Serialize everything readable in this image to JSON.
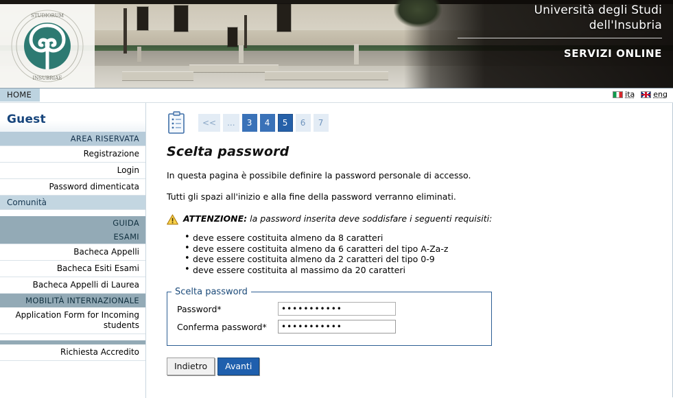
{
  "header": {
    "university_line1": "Università degli Studi",
    "university_line2": "dell'Insubria",
    "services": "SERVIZI ONLINE",
    "logo_alt": "university-seal"
  },
  "navbar": {
    "home": "HOME",
    "languages": [
      {
        "code": "ita",
        "label": "ita",
        "flag": "flag-italy-icon"
      },
      {
        "code": "eng",
        "label": "eng",
        "flag": "flag-uk-icon"
      }
    ]
  },
  "sidebar": {
    "user": "Guest",
    "sections": [
      {
        "type": "group-light",
        "label": "AREA RISERVATA"
      },
      {
        "type": "link",
        "label": "Registrazione"
      },
      {
        "type": "link",
        "label": "Login"
      },
      {
        "type": "link",
        "label": "Password dimenticata"
      },
      {
        "type": "sub",
        "label": "Comunità"
      },
      {
        "type": "spacer",
        "label": ""
      },
      {
        "type": "group-dark",
        "label": "GUIDA"
      },
      {
        "type": "group-dark",
        "label": "ESAMI"
      },
      {
        "type": "link",
        "label": "Bacheca Appelli"
      },
      {
        "type": "link",
        "label": "Bacheca Esiti Esami"
      },
      {
        "type": "link",
        "label": "Bacheca Appelli di Laurea"
      },
      {
        "type": "group-dark",
        "label": "MOBILITÀ INTERNAZIONALE"
      },
      {
        "type": "link",
        "label": "Application Form for Incoming students"
      },
      {
        "type": "rule",
        "label": ""
      },
      {
        "type": "link-plain",
        "label": "Richiesta Accredito"
      }
    ]
  },
  "content": {
    "clipboard_icon": "clipboard-checklist-icon",
    "steps": [
      {
        "label": "<<",
        "state": "nav"
      },
      {
        "label": "...",
        "state": "nav"
      },
      {
        "label": "3",
        "state": "done"
      },
      {
        "label": "4",
        "state": "done"
      },
      {
        "label": "5",
        "state": "current"
      },
      {
        "label": "6",
        "state": "pending"
      },
      {
        "label": "7",
        "state": "pending"
      }
    ],
    "title": "Scelta password",
    "paragraph1": "In questa pagina è possibile definire la password personale di accesso.",
    "paragraph2": "Tutti gli spazi all'inizio e alla fine della password verranno eliminati.",
    "warning_icon": "warning-triangle-icon",
    "warning_lead": "ATTENZIONE:",
    "warning_rest": " la password inserita deve soddisfare i seguenti requisiti:",
    "requirements": [
      "deve essere costituita almeno da 8 caratteri",
      "deve essere costituita almeno da 6 caratteri del tipo A-Za-z",
      "deve essere costituita almeno da 2 caratteri del tipo 0-9",
      "deve essere costituita al massimo da 20 caratteri"
    ],
    "form": {
      "legend": "Scelta password",
      "password_label": "Password*",
      "password_value": "•••••••••••",
      "confirm_label": "Conferma password*",
      "confirm_value": "•••••••••••"
    },
    "buttons": {
      "back": "Indietro",
      "next": "Avanti"
    }
  },
  "colors": {
    "accent_blue": "#2560a8",
    "step_done": "#3a72b8",
    "step_pending": "#e3ecf5",
    "sidebar_group_light": "#b6cbd9",
    "sidebar_group_dark": "#93aab6",
    "fieldset_border": "#2b5d93",
    "user_name": "#17457c",
    "warning_yellow": "#f6c324"
  }
}
